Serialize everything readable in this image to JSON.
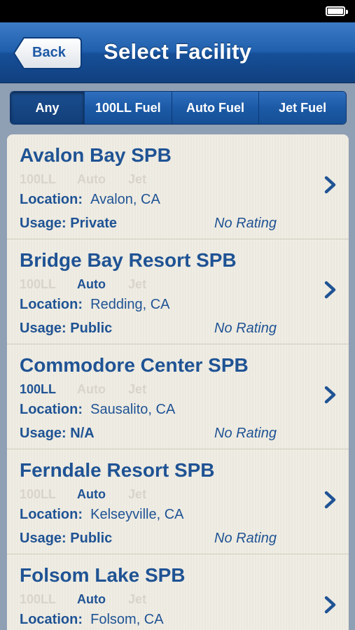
{
  "nav": {
    "back_label": "Back",
    "title": "Select Facility"
  },
  "filters": [
    "Any",
    "100LL Fuel",
    "Auto Fuel",
    "Jet Fuel"
  ],
  "selected_filter": "Any",
  "labels": {
    "location": "Location:",
    "usage": "Usage:"
  },
  "fuel_labels": [
    "100LL",
    "Auto",
    "Jet"
  ],
  "facilities": [
    {
      "name": "Avalon Bay SPB",
      "fuel": [
        false,
        false,
        false
      ],
      "location": "Avalon, CA",
      "usage": "Private",
      "rating": "No Rating"
    },
    {
      "name": "Bridge Bay Resort SPB",
      "fuel": [
        false,
        true,
        false
      ],
      "location": "Redding, CA",
      "usage": "Public",
      "rating": "No Rating"
    },
    {
      "name": "Commodore Center SPB",
      "fuel": [
        true,
        false,
        false
      ],
      "location": "Sausalito, CA",
      "usage": "N/A",
      "rating": "No Rating"
    },
    {
      "name": "Ferndale Resort SPB",
      "fuel": [
        false,
        true,
        false
      ],
      "location": "Kelseyville, CA",
      "usage": "Public",
      "rating": "No Rating"
    },
    {
      "name": "Folsom Lake SPB",
      "fuel": [
        false,
        true,
        false
      ],
      "location": "Folsom, CA",
      "usage": "",
      "rating": ""
    }
  ],
  "colors": {
    "nav_blue": "#1f5fad",
    "text_blue": "#1f5394",
    "disabled": "#d8d4cb",
    "list_bg": "#efece3"
  }
}
